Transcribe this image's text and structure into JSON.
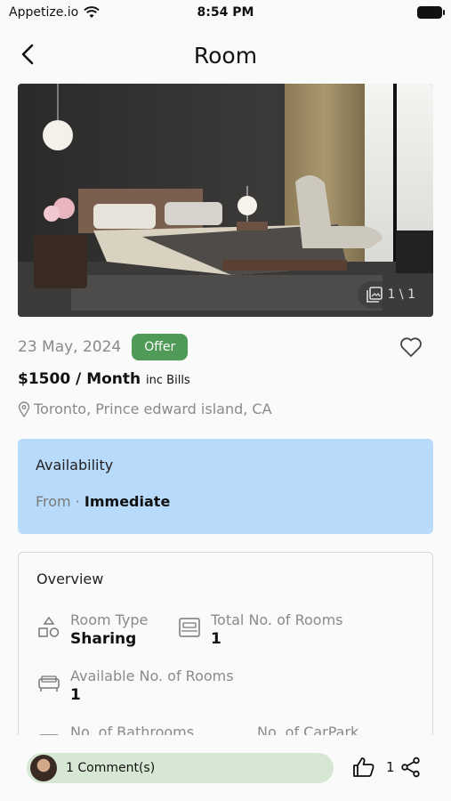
{
  "status_bar": {
    "carrier": "Appetize.io",
    "time": "8:54 PM"
  },
  "header": {
    "title": "Room"
  },
  "hero": {
    "counter": "1 \\ 1",
    "image_desc_icon": "gallery-icon"
  },
  "listing": {
    "date": "23 May, 2024",
    "badge": "Offer",
    "price": "$1500 / Month",
    "price_suffix": "inc Bills",
    "location": "Toronto, Prince edward island, CA"
  },
  "availability": {
    "heading": "Availability",
    "from_label": "From ·",
    "from_value": "Immediate"
  },
  "overview": {
    "heading": "Overview",
    "features": [
      {
        "label": "Room Type",
        "value": "Sharing",
        "icon": "shapes-icon"
      },
      {
        "label": "Total No. of Rooms",
        "value": "1",
        "icon": "bed-icon"
      },
      {
        "label": "Available No. of Rooms",
        "value": "1",
        "icon": "bed-icon"
      },
      {
        "label": "No. of Bathrooms",
        "value": "",
        "icon": "bath-icon"
      },
      {
        "label": "No. of CarPark",
        "value": "",
        "icon": "car-icon"
      }
    ]
  },
  "bottom_bar": {
    "comments": "1 Comment(s)",
    "likes": "1"
  },
  "colors": {
    "badge": "#4f9a56",
    "availability_bg": "#b9dbfb",
    "comment_bg": "#d6e7d3"
  }
}
